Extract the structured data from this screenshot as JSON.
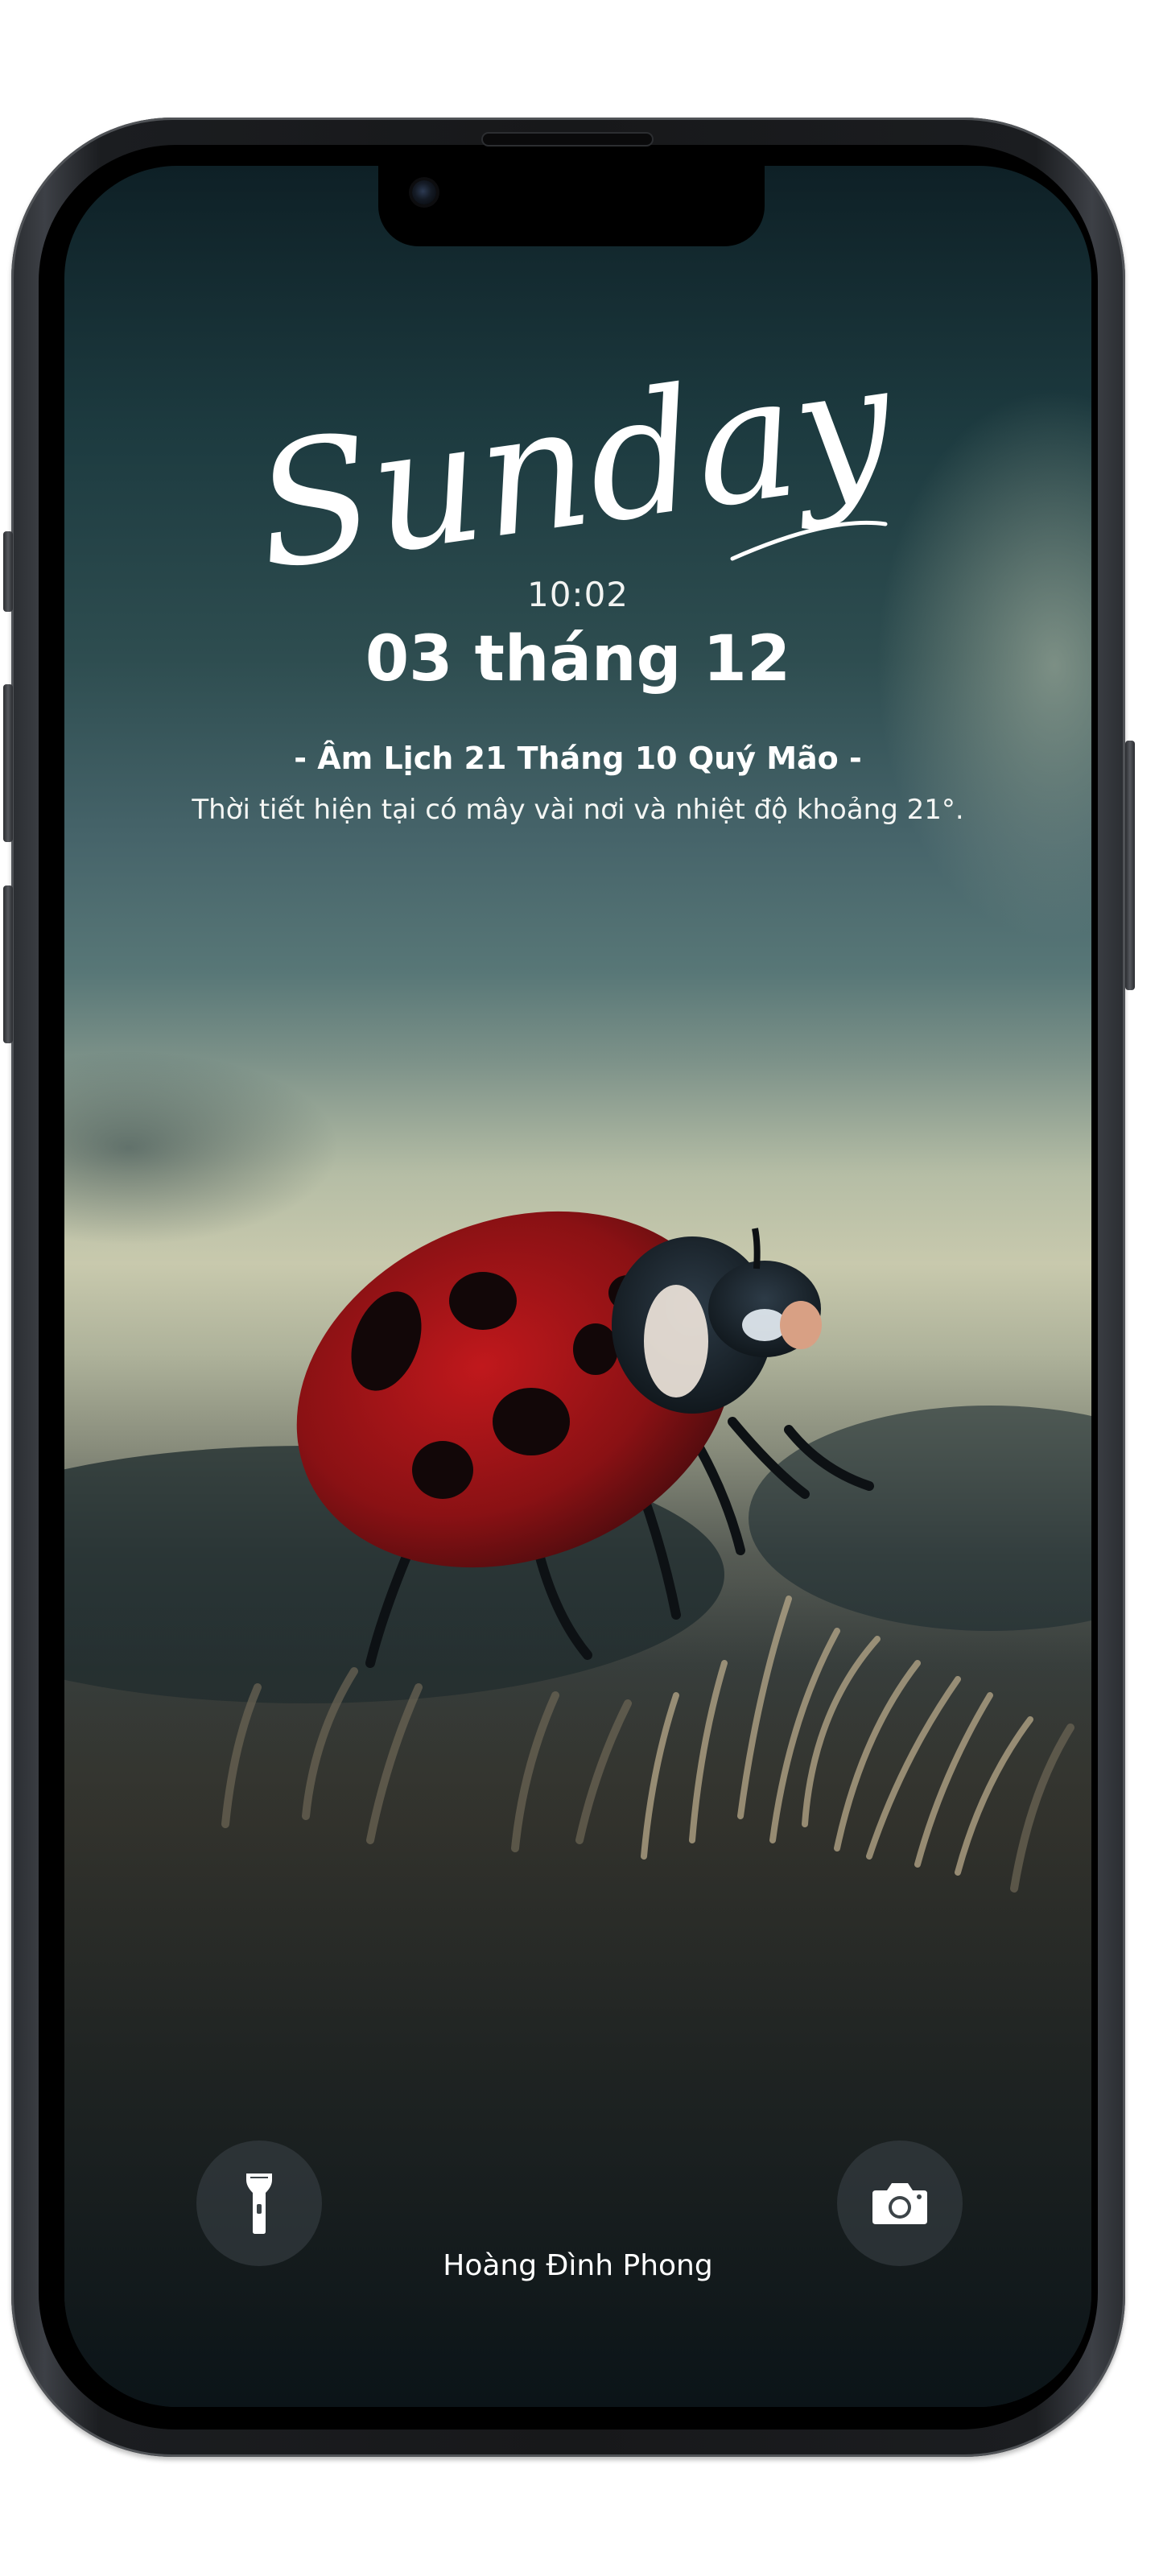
{
  "lockscreen": {
    "weekday": "Sunday",
    "time": "10:02",
    "date": "03 tháng 12",
    "lunar_date": "- Âm Lịch 21 Tháng 10 Quý Mão -",
    "weather": "Thời tiết hiện tại có mây vài nơi và nhiệt độ khoảng 21°.",
    "owner_name": "Hoàng Đình Phong"
  },
  "quick_actions": {
    "left_icon": "flashlight-icon",
    "right_icon": "camera-icon"
  },
  "wallpaper": {
    "subject": "ladybug-on-grass",
    "colors": {
      "sky_top": "#0e2026",
      "horizon": "#c8c9ad",
      "ground": "#3a3a34",
      "ladybug_red": "#b8141a",
      "ladybug_head": "#1a2630"
    }
  }
}
